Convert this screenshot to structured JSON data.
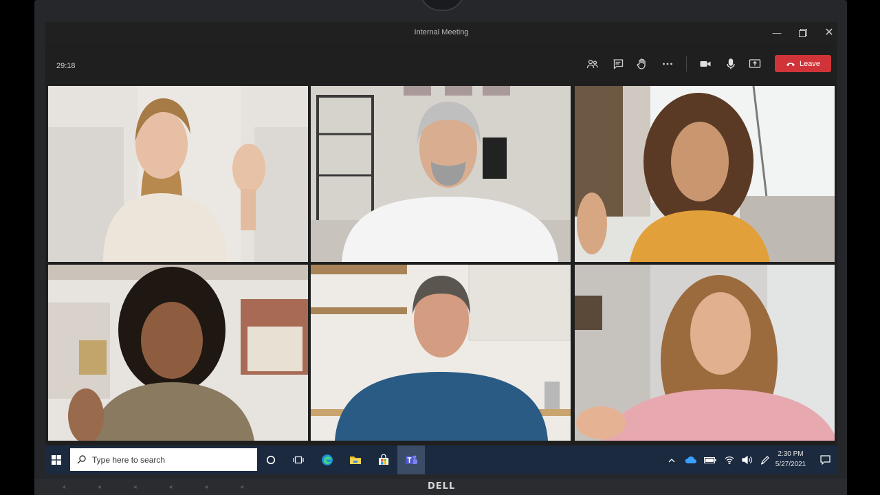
{
  "window": {
    "title": "Internal Meeting"
  },
  "meeting": {
    "timer": "29:18",
    "leave_label": "Leave",
    "toolbar_icons": [
      "people-icon",
      "chat-icon",
      "raise-hand-icon",
      "more-icon",
      "camera-icon",
      "mic-icon",
      "share-icon",
      "phone-hangup-icon"
    ]
  },
  "colors": {
    "leave_red": "#d13438",
    "taskbar": "#1b2a3f",
    "titlebar": "#202020"
  },
  "taskbar": {
    "search_placeholder": "Type here to search",
    "time": "2:30 PM",
    "date": "5/27/2021"
  },
  "device": {
    "brand": "DELL"
  }
}
